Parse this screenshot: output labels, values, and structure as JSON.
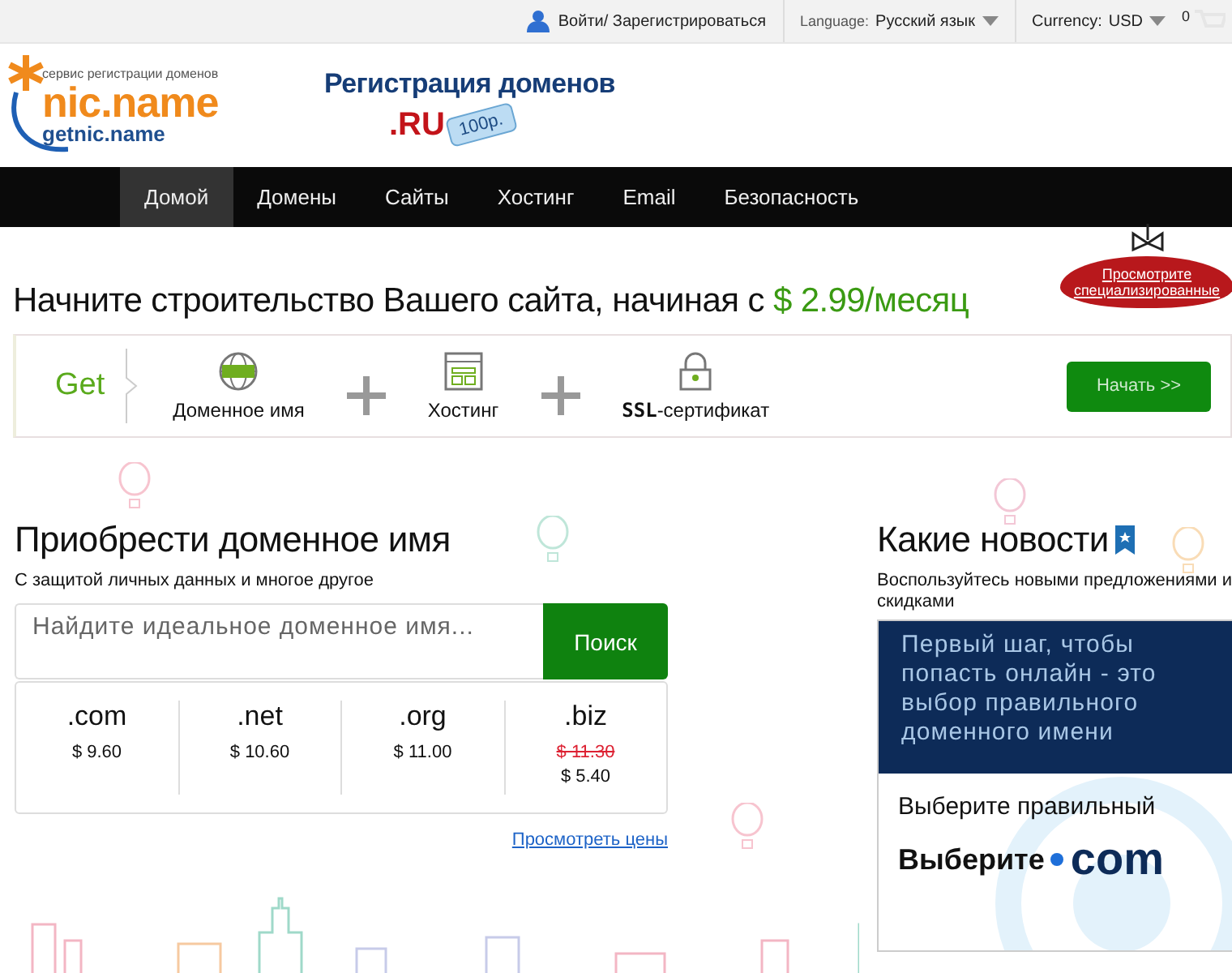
{
  "top_bar": {
    "login": "Войти/ Зарегистрироваться",
    "language_label": "Language:",
    "language": "Русский язык",
    "currency_label": "Currency:",
    "currency": "USD",
    "cart_count": "0"
  },
  "header": {
    "logo_tagline": "сервис регистрации доменов",
    "logo_name": "nic.name",
    "logo_domain": "getnic.name",
    "promo_title": "Регистрация доменов",
    "promo_zone": ".RU",
    "promo_price": "100р."
  },
  "nav": [
    {
      "label": "Домой",
      "selected": true
    },
    {
      "label": "Домены",
      "selected": false
    },
    {
      "label": "Сайты",
      "selected": false
    },
    {
      "label": "Хостинг",
      "selected": false
    },
    {
      "label": "Email",
      "selected": false
    },
    {
      "label": "Безопасность",
      "selected": false
    }
  ],
  "promo_tag": {
    "lines": [
      "Просмотрите",
      "специализированные"
    ]
  },
  "headline": {
    "text": "Начните строительство Вашего сайта, начиная с",
    "price": "$ 2.99/месяц"
  },
  "offer": {
    "lead": "Get",
    "items": [
      {
        "kind": "globe",
        "label": "Доменное имя"
      },
      {
        "kind": "hosting",
        "label": "Хостинг"
      },
      {
        "kind": "lock",
        "label": "**SSL**-сертификат"
      }
    ],
    "button": "Начать >>"
  },
  "domain_search": {
    "title": "Приобрести доменное имя",
    "subtitle": "С защитой личных данных и многое другое",
    "placeholder": "Найдите идеальное доменное имя...",
    "button": "Поиск",
    "zones": [
      {
        "name": ".com",
        "price": "$ 9.60"
      },
      {
        "name": ".net",
        "price": "$ 10.60"
      },
      {
        "name": ".org",
        "price": "$ 11.00"
      },
      {
        "name": ".biz",
        "old_price": "$ 11.30",
        "price": "$ 5.40"
      }
    ],
    "link": "Просмотреть цены"
  },
  "news": {
    "title": "Какие новости",
    "subtitle": "Воспользуйтесь новыми предложениями и скидками",
    "banner": {
      "headline": "Первый шаг, чтобы попасть онлайн - это выбор правильного доменного имени",
      "line": "Выберите правильный",
      "brand_word": "Выберите",
      "brand_zone": "com"
    }
  }
}
